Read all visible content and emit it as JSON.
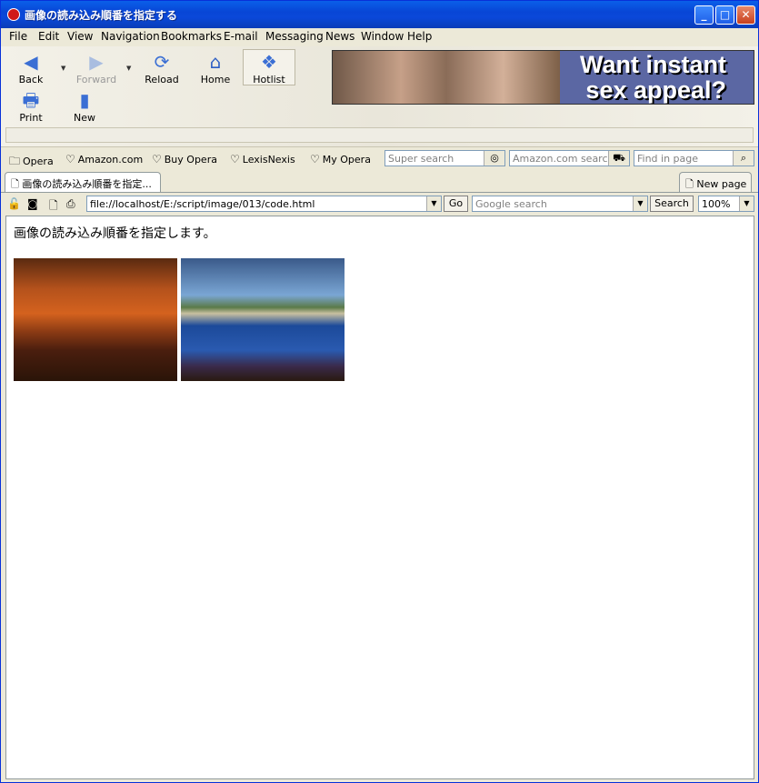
{
  "window": {
    "title": "画像の読み込み順番を指定する"
  },
  "menu": [
    "File",
    "Edit",
    "View",
    "Navigation",
    "Bookmarks",
    "E-mail",
    "Messaging",
    "News",
    "Window",
    "Help"
  ],
  "toolbar": {
    "back": "Back",
    "forward": "Forward",
    "reload": "Reload",
    "home": "Home",
    "hotlist": "Hotlist",
    "print": "Print",
    "new": "New"
  },
  "banner": {
    "line1": "Want instant",
    "line2": "sex appeal?"
  },
  "bookmarks": [
    "Opera",
    "Amazon.com",
    "Buy Opera",
    "LexisNexis",
    "My Opera"
  ],
  "searches": {
    "super": "Super search",
    "amazon": "Amazon.com search",
    "find": "Find in page"
  },
  "tabs": {
    "active": "画像の読み込み順番を指定...",
    "new_page": "New page"
  },
  "address": {
    "url": "file://localhost/E:/script/image/013/code.html",
    "go": "Go",
    "google_placeholder": "Google search",
    "search_button": "Search",
    "zoom": "100%"
  },
  "page": {
    "text": "画像の読み込み順番を指定します。"
  }
}
